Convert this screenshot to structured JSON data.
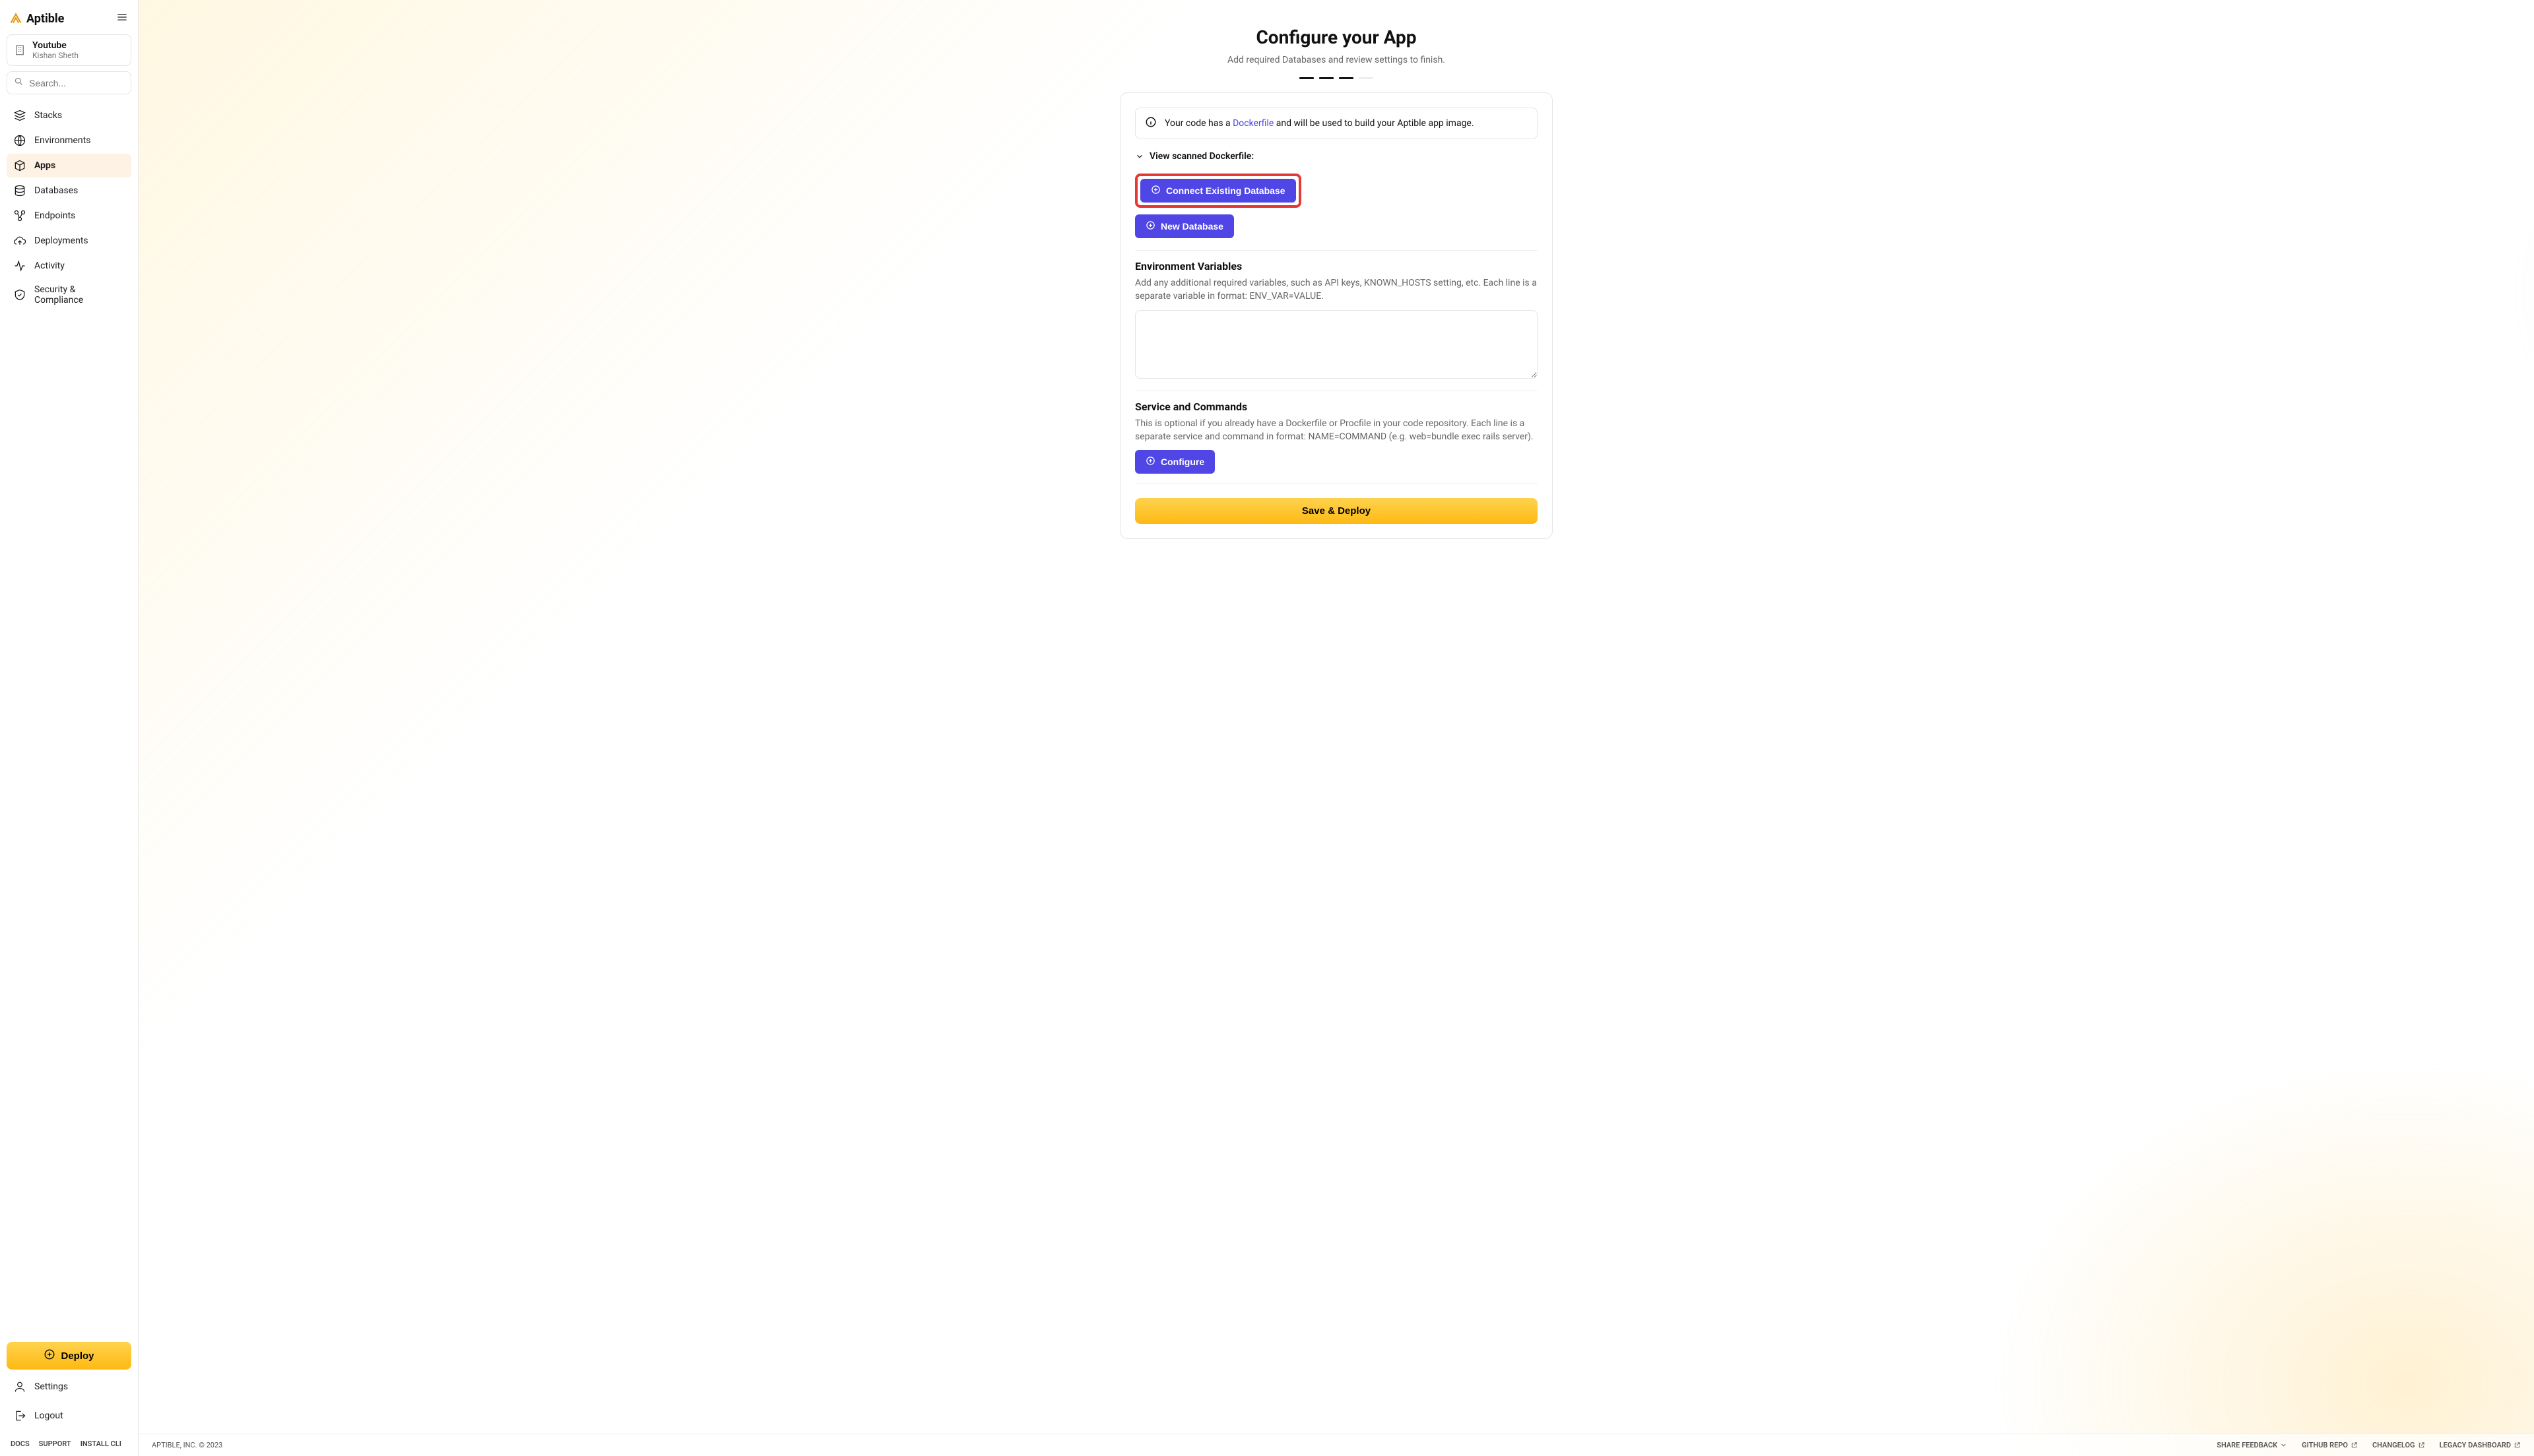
{
  "brand": "Aptible",
  "org": {
    "name": "Youtube",
    "user": "Kishan Sheth"
  },
  "search": {
    "placeholder": "Search..."
  },
  "sidebar": {
    "items": [
      {
        "label": "Stacks"
      },
      {
        "label": "Environments"
      },
      {
        "label": "Apps"
      },
      {
        "label": "Databases"
      },
      {
        "label": "Endpoints"
      },
      {
        "label": "Deployments"
      },
      {
        "label": "Activity"
      },
      {
        "label": "Security & Compliance"
      }
    ],
    "deploy": "Deploy",
    "settings": "Settings",
    "logout": "Logout",
    "footer": [
      "DOCS",
      "SUPPORT",
      "INSTALL CLI"
    ]
  },
  "main": {
    "title": "Configure your App",
    "subtitle": "Add required Databases and review settings to finish.",
    "banner_pre": "Your code has a ",
    "banner_link": "Dockerfile",
    "banner_post": " and will be used to build your Aptible app image.",
    "view_dockerfile": "View scanned Dockerfile:",
    "connect_db": "Connect Existing Database",
    "new_db": "New Database",
    "env_title": "Environment Variables",
    "env_desc": "Add any additional required variables, such as API keys, KNOWN_HOSTS setting, etc. Each line is a separate variable in format: ENV_VAR=VALUE.",
    "svc_title": "Service and Commands",
    "svc_desc": "This is optional if you already have a Dockerfile or Procfile in your code repository. Each line is a separate service and command in format: NAME=COMMAND (e.g. web=bundle exec rails server).",
    "configure": "Configure",
    "save": "Save & Deploy"
  },
  "footer": {
    "left": "APTIBLE, INC. © 2023",
    "right": [
      "SHARE FEEDBACK",
      "GITHUB REPO",
      "CHANGELOG",
      "LEGACY DASHBOARD"
    ]
  }
}
